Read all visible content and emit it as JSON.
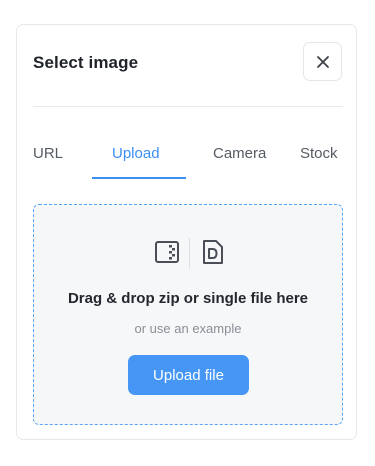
{
  "dialog": {
    "title": "Select image",
    "close_icon": "close-icon"
  },
  "tabs": [
    {
      "label": "URL",
      "active": false
    },
    {
      "label": "Upload",
      "active": true
    },
    {
      "label": "Camera",
      "active": false
    },
    {
      "label": "Stock",
      "active": false
    }
  ],
  "dropzone": {
    "icons": [
      "zip-file-icon",
      "document-file-icon"
    ],
    "drop_text": "Drag & drop zip or single file here",
    "example_text": "or use an example",
    "upload_button_label": "Upload file"
  },
  "colors": {
    "accent": "#4596f5",
    "active_tab": "#3d8ff4",
    "dropzone_border": "#5aa4f7"
  }
}
